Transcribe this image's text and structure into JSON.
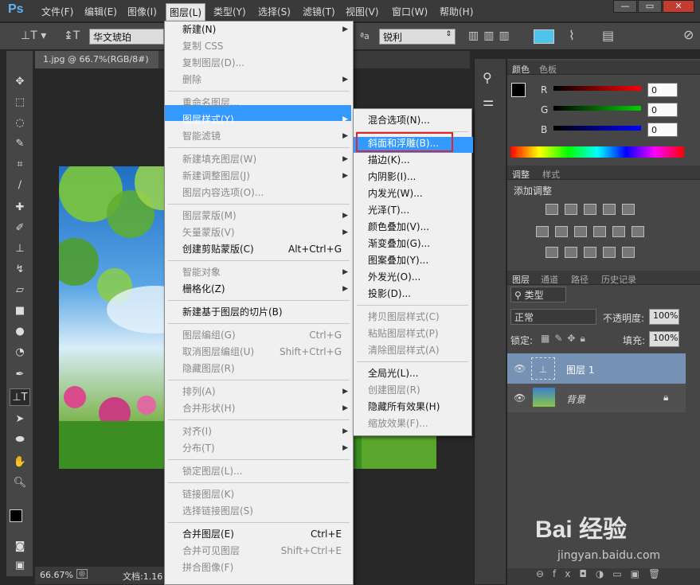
{
  "app": {
    "logo": "Ps",
    "win_controls": [
      "—",
      "▭",
      "✕"
    ]
  },
  "menubar": [
    "文件(F)",
    "编辑(E)",
    "图像(I)",
    "图层(L)",
    "类型(Y)",
    "选择(S)",
    "滤镜(T)",
    "视图(V)",
    "窗口(W)",
    "帮助(H)"
  ],
  "options": {
    "font_name": "华文琥珀",
    "aa_label": "ªa",
    "aa_value": "锐利",
    "color_swatch": "#4fc4ea"
  },
  "doc_tab": "1.jpg @ 66.7%(RGB/8#)",
  "status": {
    "zoom": "66.67%",
    "doc": "文档:1.16"
  },
  "color_panel": {
    "tabs": [
      "颜色",
      "色板"
    ],
    "labels": [
      "R",
      "G",
      "B"
    ],
    "values": [
      "0",
      "0",
      "0"
    ]
  },
  "adjust_panel": {
    "tabs": [
      "调整",
      "样式"
    ],
    "title": "添加调整"
  },
  "layers_panel": {
    "tabs": [
      "图层",
      "通道",
      "路径",
      "历史记录"
    ],
    "kind": "类型",
    "blend": "正常",
    "opacity_label": "不透明度:",
    "opacity": "100%",
    "lock_label": "锁定:",
    "fill_label": "填充:",
    "fill": "100%",
    "layers": [
      "图层 1",
      "背景"
    ]
  },
  "layer_menu": [
    {
      "label": "新建(N)",
      "sub": true
    },
    {
      "label": "复制 CSS",
      "dis": true
    },
    {
      "label": "复制图层(D)...",
      "dis": true
    },
    {
      "label": "删除",
      "dis": true,
      "sub": true
    },
    {
      "sep": true
    },
    {
      "label": "重命名图层...",
      "dis": true
    },
    {
      "label": "图层样式(Y)",
      "sub": true,
      "hl": true
    },
    {
      "label": "智能滤镜",
      "dis": true,
      "sub": true
    },
    {
      "sep": true
    },
    {
      "label": "新建填充图层(W)",
      "dis": true,
      "sub": true
    },
    {
      "label": "新建调整图层(J)",
      "dis": true,
      "sub": true
    },
    {
      "label": "图层内容选项(O)...",
      "dis": true
    },
    {
      "sep": true
    },
    {
      "label": "图层蒙版(M)",
      "dis": true,
      "sub": true
    },
    {
      "label": "矢量蒙版(V)",
      "dis": true,
      "sub": true
    },
    {
      "label": "创建剪贴蒙版(C)",
      "sc": "Alt+Ctrl+G"
    },
    {
      "sep": true
    },
    {
      "label": "智能对象",
      "dis": true,
      "sub": true
    },
    {
      "label": "栅格化(Z)",
      "sub": true
    },
    {
      "sep": true
    },
    {
      "label": "新建基于图层的切片(B)"
    },
    {
      "sep": true
    },
    {
      "label": "图层编组(G)",
      "dis": true,
      "sc": "Ctrl+G"
    },
    {
      "label": "取消图层编组(U)",
      "dis": true,
      "sc": "Shift+Ctrl+G"
    },
    {
      "label": "隐藏图层(R)",
      "dis": true
    },
    {
      "sep": true
    },
    {
      "label": "排列(A)",
      "dis": true,
      "sub": true
    },
    {
      "label": "合并形状(H)",
      "dis": true,
      "sub": true
    },
    {
      "sep": true
    },
    {
      "label": "对齐(I)",
      "dis": true,
      "sub": true
    },
    {
      "label": "分布(T)",
      "dis": true,
      "sub": true
    },
    {
      "sep": true
    },
    {
      "label": "锁定图层(L)...",
      "dis": true
    },
    {
      "sep": true
    },
    {
      "label": "链接图层(K)",
      "dis": true
    },
    {
      "label": "选择链接图层(S)",
      "dis": true
    },
    {
      "sep": true
    },
    {
      "label": "合并图层(E)",
      "sc": "Ctrl+E"
    },
    {
      "label": "合并可见图层",
      "dis": true,
      "sc": "Shift+Ctrl+E"
    },
    {
      "label": "拼合图像(F)",
      "dis": true
    }
  ],
  "style_menu": [
    {
      "label": "混合选项(N)..."
    },
    {
      "sep": true
    },
    {
      "label": "斜面和浮雕(B)...",
      "hl": true
    },
    {
      "label": "描边(K)..."
    },
    {
      "label": "内阴影(I)..."
    },
    {
      "label": "内发光(W)..."
    },
    {
      "label": "光泽(T)..."
    },
    {
      "label": "颜色叠加(V)..."
    },
    {
      "label": "渐变叠加(G)..."
    },
    {
      "label": "图案叠加(Y)..."
    },
    {
      "label": "外发光(O)..."
    },
    {
      "label": "投影(D)..."
    },
    {
      "sep": true
    },
    {
      "label": "拷贝图层样式(C)",
      "dis": true
    },
    {
      "label": "粘贴图层样式(P)",
      "dis": true
    },
    {
      "label": "清除图层样式(A)",
      "dis": true
    },
    {
      "sep": true
    },
    {
      "label": "全局光(L)..."
    },
    {
      "label": "创建图层(R)",
      "dis": true
    },
    {
      "label": "隐藏所有效果(H)"
    },
    {
      "label": "缩放效果(F)...",
      "dis": true
    }
  ],
  "watermark": {
    "text": "Bai 经验",
    "sub": "jingyan.baidu.com"
  }
}
